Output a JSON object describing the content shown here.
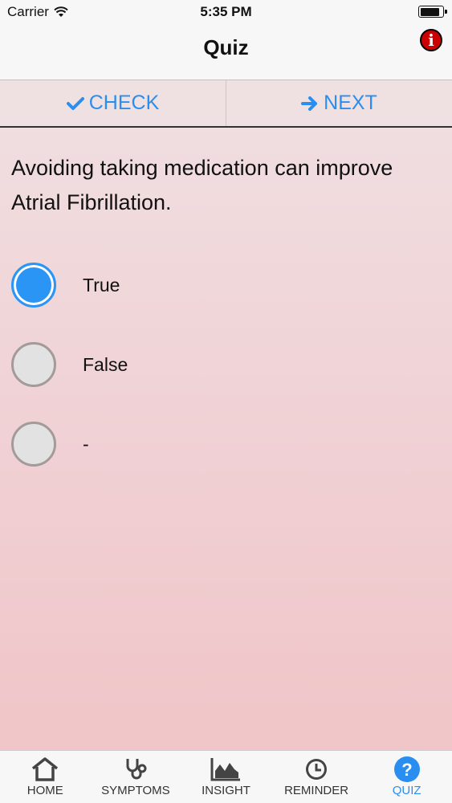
{
  "status": {
    "carrier": "Carrier",
    "time": "5:35 PM"
  },
  "nav": {
    "title": "Quiz",
    "info_icon": "info-icon"
  },
  "actions": {
    "check": "CHECK",
    "next": "NEXT"
  },
  "question": "Avoiding taking medication can improve Atrial Fibrillation.",
  "options": [
    {
      "label": "True",
      "selected": true
    },
    {
      "label": "False",
      "selected": false
    },
    {
      "label": "-",
      "selected": false
    }
  ],
  "tabs": [
    {
      "label": "HOME",
      "icon": "home-icon"
    },
    {
      "label": "SYMPTOMS",
      "icon": "stethoscope-icon"
    },
    {
      "label": "INSIGHT",
      "icon": "chart-icon"
    },
    {
      "label": "REMINDER",
      "icon": "clock-icon"
    },
    {
      "label": "QUIZ",
      "icon": "question-icon",
      "active": true
    }
  ],
  "colors": {
    "accent": "#2a8ef0",
    "info": "#cc0000"
  }
}
